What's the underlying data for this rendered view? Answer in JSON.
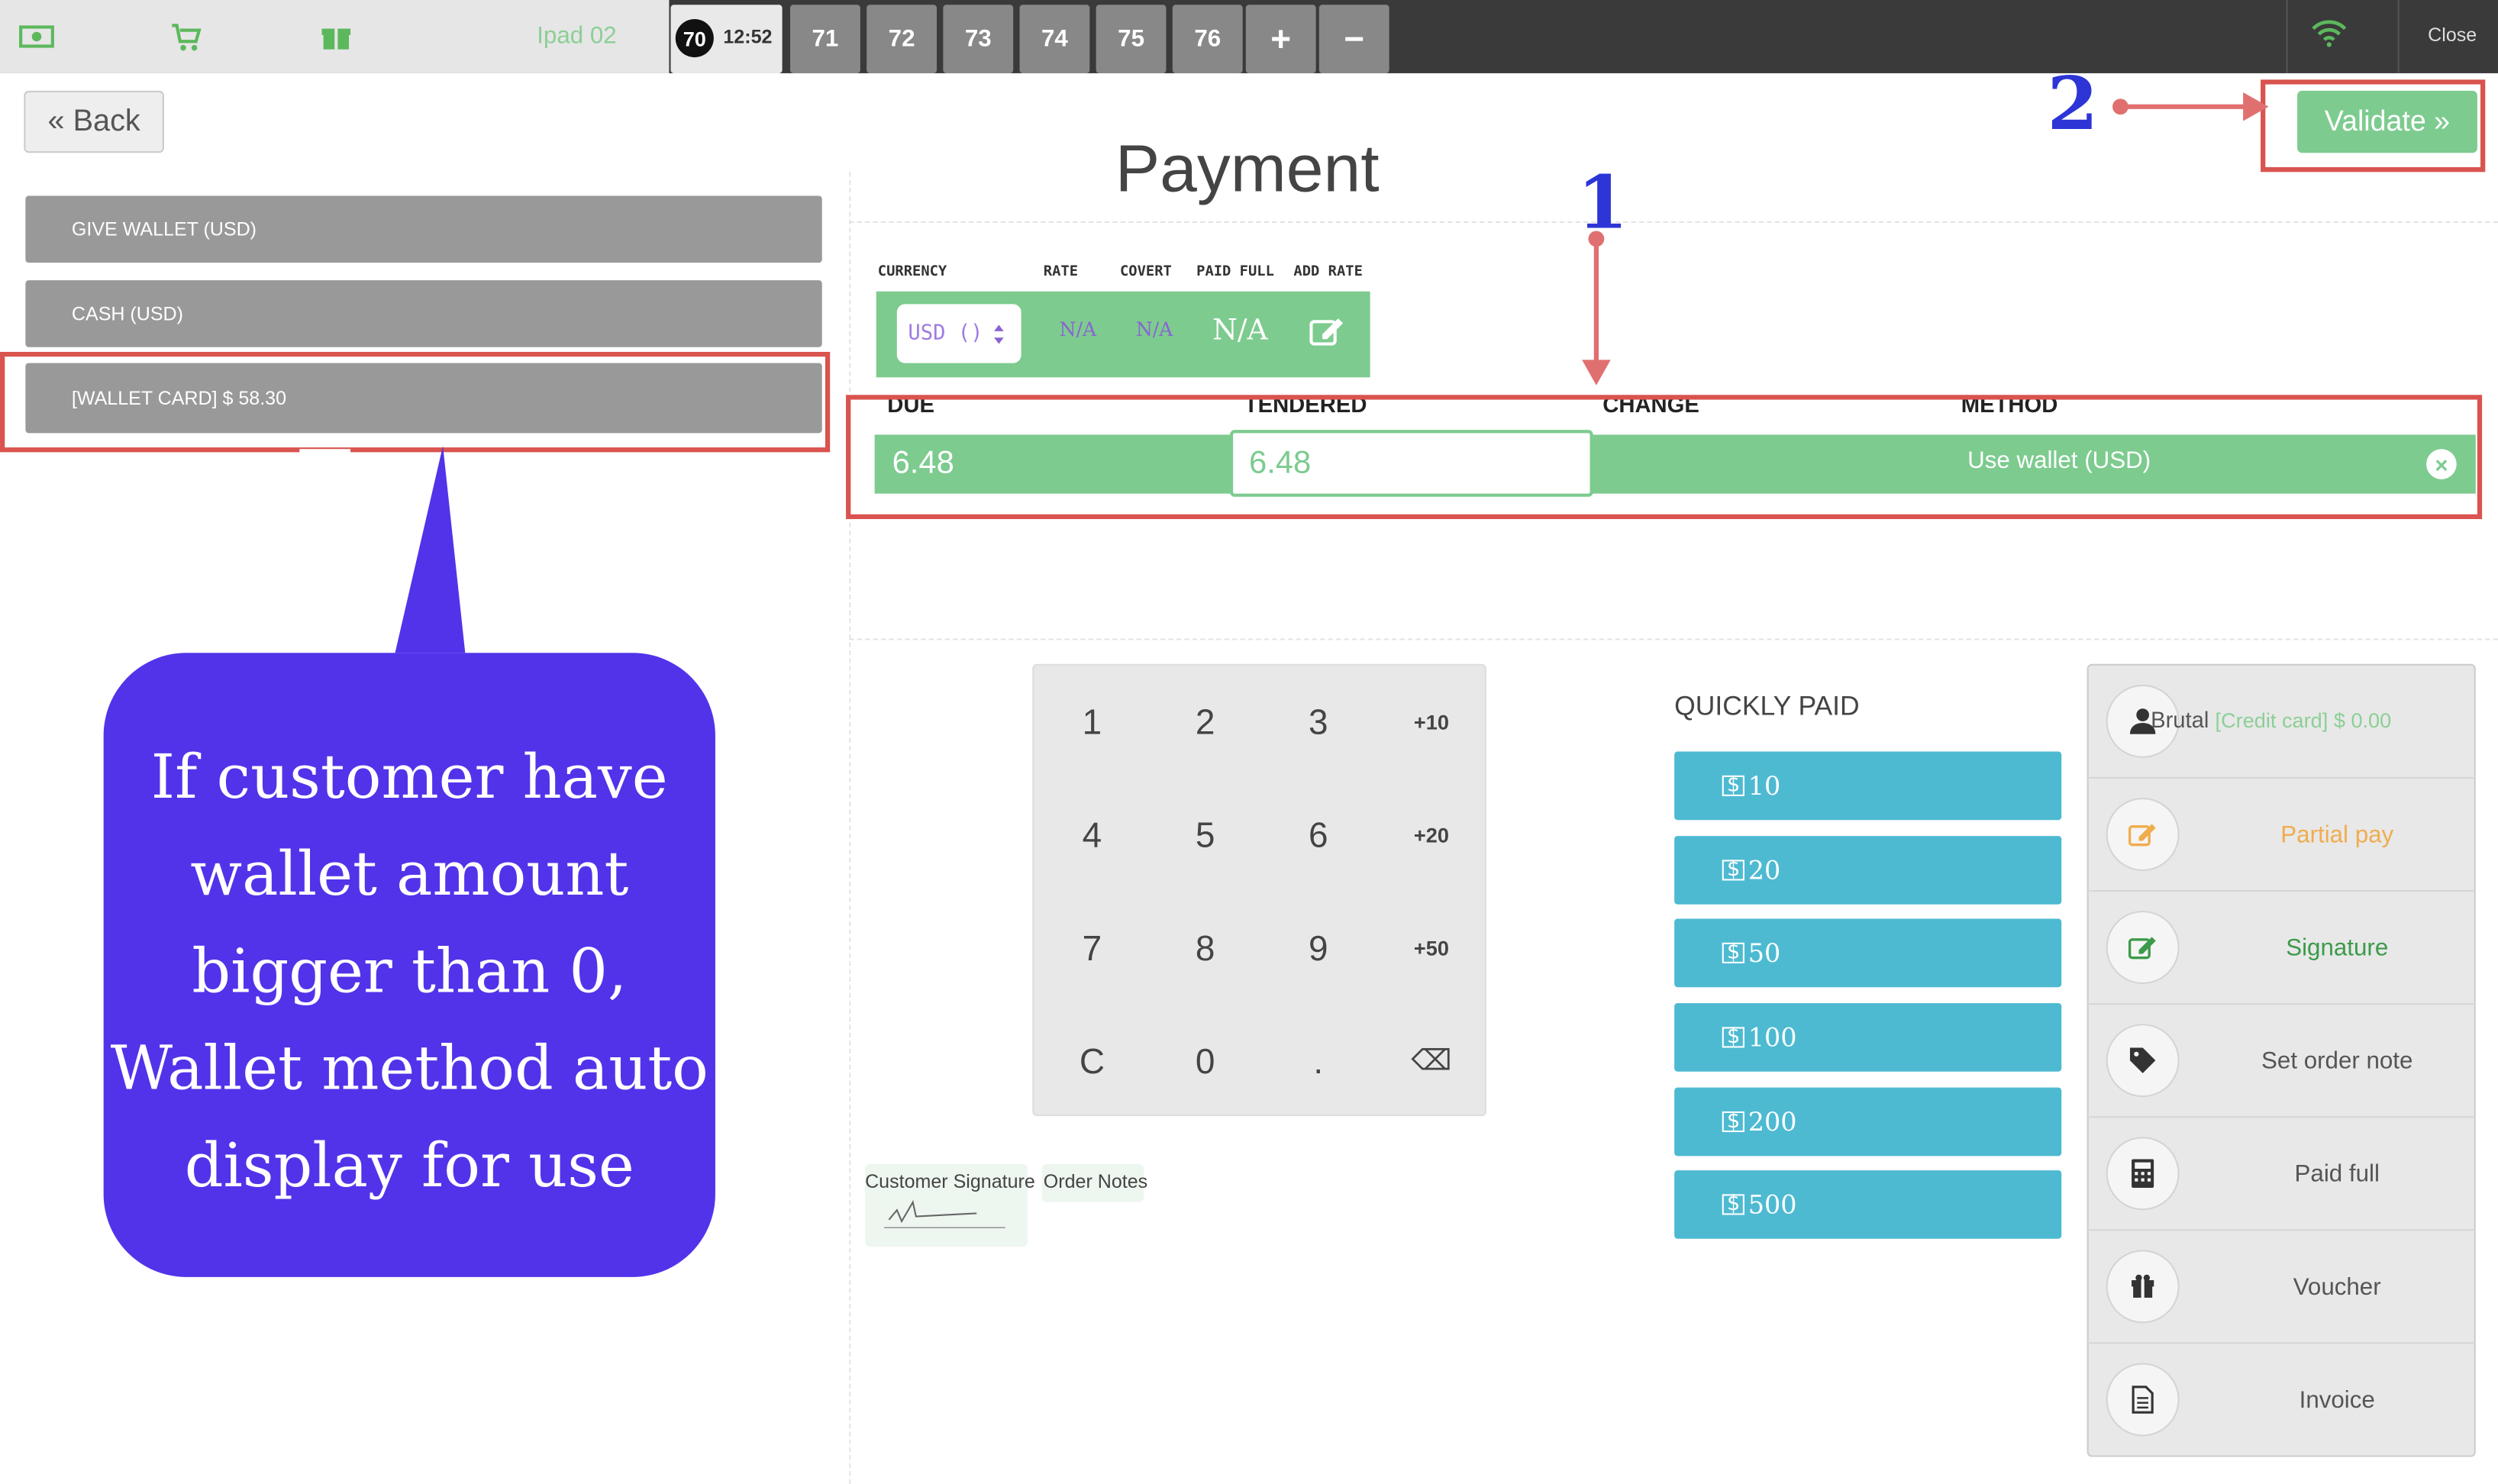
{
  "topbar": {
    "device_name": "Ipad 02",
    "active_table": "70",
    "time": "12:52",
    "tables": [
      "71",
      "72",
      "73",
      "74",
      "75",
      "76"
    ],
    "plus": "+",
    "minus": "−",
    "close": "Close"
  },
  "header": {
    "back_label": "« Back",
    "title": "Payment",
    "validate_label": "Validate »"
  },
  "payment_methods": [
    {
      "label": "GIVE WALLET (USD)"
    },
    {
      "label": "CASH (USD)"
    },
    {
      "label": "[WALLET CARD] $ 58.30"
    }
  ],
  "currency": {
    "headers": [
      "CURRENCY",
      "RATE",
      "COVERT",
      "PAID FULL",
      "ADD RATE"
    ],
    "selected": "USD ()",
    "rate": "N/A",
    "covert": "N/A",
    "paid_full": "N/A"
  },
  "payment_line": {
    "headers": [
      "DUE",
      "TENDERED",
      "CHANGE",
      "METHOD"
    ],
    "due": "6.48",
    "tendered": "6.48",
    "change": "",
    "method": "Use wallet (USD)"
  },
  "numpad": [
    "1",
    "2",
    "3",
    "+10",
    "4",
    "5",
    "6",
    "+20",
    "7",
    "8",
    "9",
    "+50",
    "C",
    "0",
    ".",
    "⌫"
  ],
  "quickly_paid": {
    "title": "QUICKLY PAID",
    "amounts": [
      "10",
      "20",
      "50",
      "100",
      "200",
      "500"
    ]
  },
  "actions": {
    "customer_name": "Brutal",
    "customer_detail": "[Credit card] $ 0.00",
    "partial_pay": "Partial pay",
    "signature": "Signature",
    "set_order_note": "Set order note",
    "paid_full": "Paid full",
    "voucher": "Voucher",
    "invoice": "Invoice"
  },
  "bottom_links": {
    "customer_signature": "Customer Signature",
    "order_notes": "Order Notes"
  },
  "annotations": {
    "callout_text": "If customer have wallet amount bigger than 0, Wallet method auto display for use",
    "marker_1": "1",
    "marker_2": "2"
  },
  "colors": {
    "accent_green": "#7dcb8f",
    "quick_blue": "#4dbad2",
    "callout_purple": "#5233ea",
    "highlight_red": "#d9534f",
    "orange": "#f0ad4e"
  }
}
